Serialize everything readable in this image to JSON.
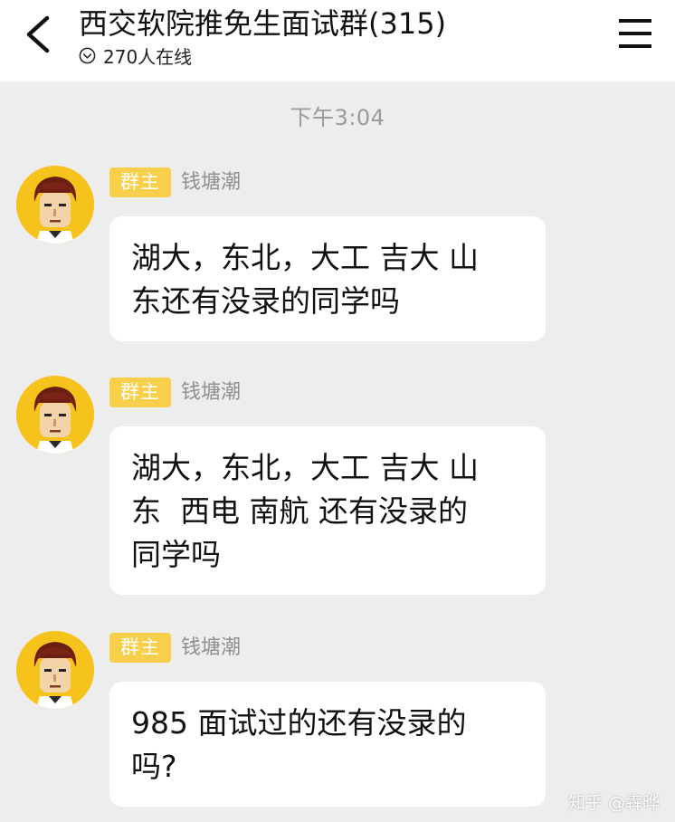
{
  "header": {
    "title": "西交软院推免生面试群(315)",
    "online_count": "270人在线",
    "back_icon": "chevron-left-icon",
    "menu_icon": "hamburger-menu-icon"
  },
  "timestamp": "下午3:04",
  "messages": [
    {
      "role_badge": "群主",
      "sender": "钱塘潮",
      "text": "湖大，东北，大工 吉大 山\n东还有没录的同学吗"
    },
    {
      "role_badge": "群主",
      "sender": "钱塘潮",
      "text": "湖大，东北，大工 吉大 山\n东  西电 南航 还有没录的\n同学吗"
    },
    {
      "role_badge": "群主",
      "sender": "钱塘潮",
      "text": "985 面试过的还有没录的\n吗?"
    }
  ],
  "watermark": "知乎 @犇晔",
  "colors": {
    "background": "#ededed",
    "header_bg": "#ffffff",
    "badge_bg": "#f7cf4a",
    "avatar_bg": "#f6c21c",
    "timestamp": "#9a9a9a"
  }
}
